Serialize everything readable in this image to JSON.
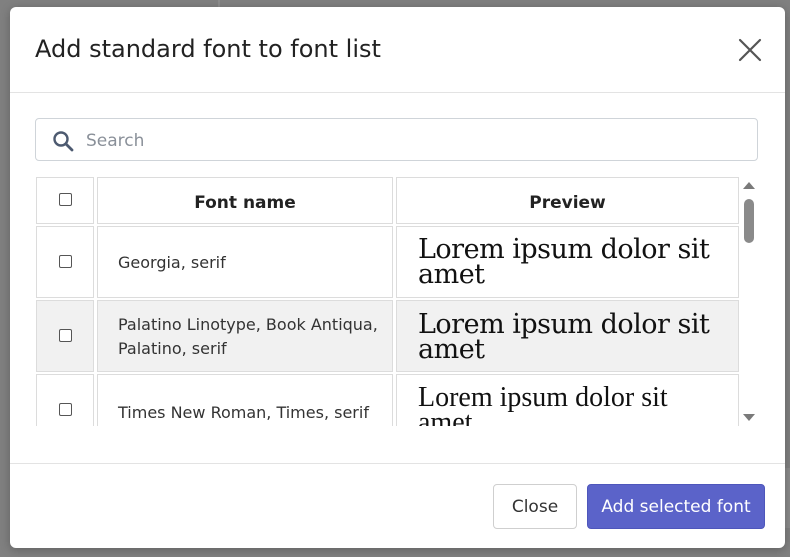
{
  "dialog": {
    "title": "Add standard font to font list",
    "close_icon": "close-icon"
  },
  "search": {
    "placeholder": "Search",
    "value": "",
    "icon": "search-icon"
  },
  "table": {
    "columns": [
      "",
      "Font name",
      "Preview"
    ],
    "rows": [
      {
        "font_name": "Georgia, serif",
        "preview": "Lorem ipsum dolor sit amet",
        "checked": false
      },
      {
        "font_name": "Palatino Linotype, Book Antiqua, Palatino, serif",
        "preview": "Lorem ipsum dolor sit amet",
        "checked": false
      },
      {
        "font_name": "Times New Roman, Times, serif",
        "preview": "Lorem ipsum dolor sit amet",
        "checked": false
      }
    ]
  },
  "footer": {
    "close_label": "Close",
    "add_label": "Add selected font"
  },
  "colors": {
    "primary_button": "#5b63c9",
    "row_highlight": "#f1f1f1",
    "backdrop": "#808080"
  }
}
